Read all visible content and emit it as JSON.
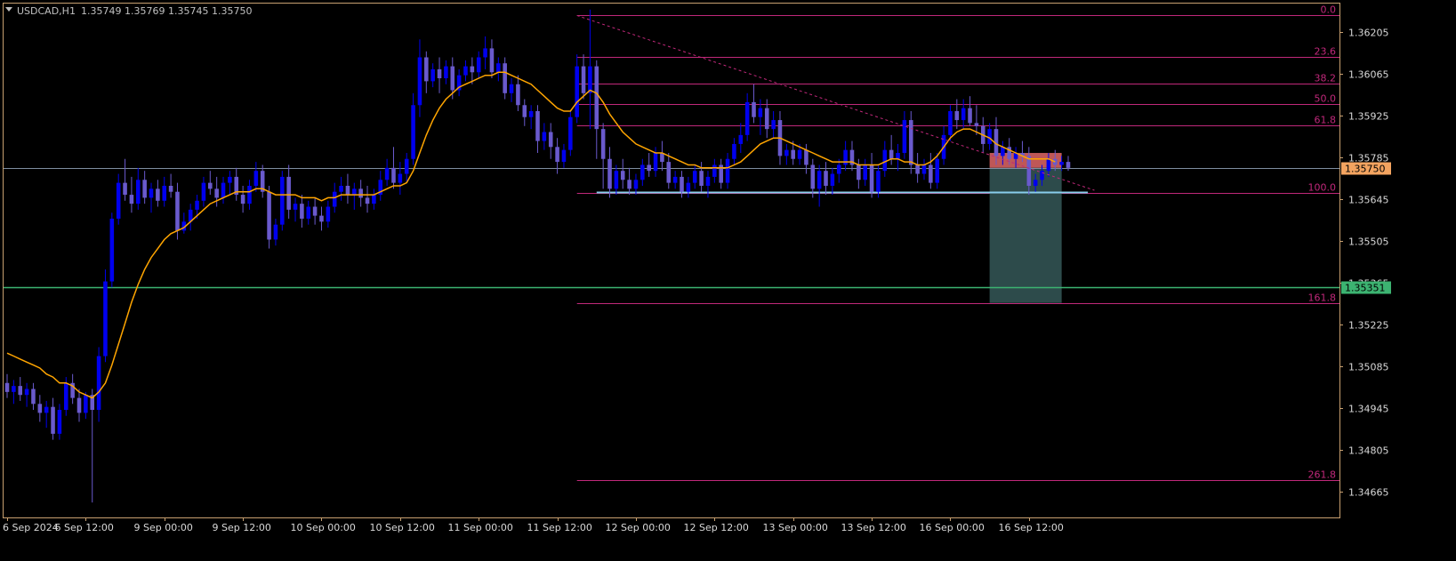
{
  "header": {
    "symbol": "USDCAD,H1",
    "ohlc": "1.35749 1.35769 1.35745 1.35750",
    "dropdown_icon": "triangle-down-icon"
  },
  "colors": {
    "background": "#000000",
    "frame": "#c8a070",
    "bull_candle": "#0000ee",
    "bear_candle": "#6a5acd",
    "moving_average": "#ffa500",
    "fib_level": "#c0287a",
    "fib_text": "#c0287a",
    "trend_line": "#c0287a",
    "support_line": "#87ceeb",
    "price_line": "#7f8da0",
    "target_line": "#3cb371",
    "risk_box": "#e06666",
    "reward_box": "#2f4f4f",
    "current_price_label": "#f4a460",
    "target_price_label": "#3cb371"
  },
  "chart_data": {
    "type": "candlestick",
    "symbol": "USDCAD",
    "timeframe": "H1",
    "ylim": [
      1.3458,
      1.363
    ],
    "grid": false,
    "y_ticks": [
      "1.36205",
      "1.36065",
      "1.35925",
      "1.35785",
      "1.35645",
      "1.35505",
      "1.35365",
      "1.35225",
      "1.35085",
      "1.34945",
      "1.34805",
      "1.34665"
    ],
    "x_ticks": [
      "6 Sep 2024",
      "6 Sep 12:00",
      "9 Sep 00:00",
      "9 Sep 12:00",
      "10 Sep 00:00",
      "10 Sep 12:00",
      "11 Sep 00:00",
      "11 Sep 12:00",
      "12 Sep 00:00",
      "12 Sep 12:00",
      "13 Sep 00:00",
      "13 Sep 12:00",
      "16 Sep 00:00",
      "16 Sep 12:00"
    ],
    "candles": [
      [
        1.3503,
        1.3506,
        1.3498,
        1.35
      ],
      [
        1.35,
        1.3504,
        1.3496,
        1.3502
      ],
      [
        1.3502,
        1.3505,
        1.3497,
        1.3499
      ],
      [
        1.3499,
        1.3503,
        1.3495,
        1.3501
      ],
      [
        1.3501,
        1.3503,
        1.3494,
        1.3496
      ],
      [
        1.3496,
        1.3499,
        1.349,
        1.3493
      ],
      [
        1.3493,
        1.3497,
        1.3488,
        1.3495
      ],
      [
        1.3495,
        1.3498,
        1.3484,
        1.3486
      ],
      [
        1.3486,
        1.3496,
        1.3484,
        1.3494
      ],
      [
        1.3494,
        1.3505,
        1.3492,
        1.3503
      ],
      [
        1.3503,
        1.3506,
        1.3496,
        1.3498
      ],
      [
        1.3498,
        1.3501,
        1.349,
        1.3493
      ],
      [
        1.3493,
        1.35,
        1.3491,
        1.3499
      ],
      [
        1.3499,
        1.3501,
        1.3463,
        1.3494
      ],
      [
        1.3494,
        1.3515,
        1.349,
        1.3512
      ],
      [
        1.3512,
        1.3541,
        1.351,
        1.3537
      ],
      [
        1.3537,
        1.356,
        1.3535,
        1.3558
      ],
      [
        1.3558,
        1.3573,
        1.3556,
        1.357
      ],
      [
        1.357,
        1.3578,
        1.3564,
        1.3566
      ],
      [
        1.3566,
        1.3572,
        1.356,
        1.3563
      ],
      [
        1.3563,
        1.3575,
        1.3561,
        1.3571
      ],
      [
        1.3571,
        1.3574,
        1.3563,
        1.3565
      ],
      [
        1.3565,
        1.357,
        1.356,
        1.3568
      ],
      [
        1.3568,
        1.3571,
        1.3562,
        1.3564
      ],
      [
        1.3564,
        1.3572,
        1.3562,
        1.3569
      ],
      [
        1.3569,
        1.3573,
        1.3565,
        1.3567
      ],
      [
        1.3567,
        1.357,
        1.3551,
        1.3554
      ],
      [
        1.3554,
        1.356,
        1.3553,
        1.3557
      ],
      [
        1.3557,
        1.3563,
        1.3554,
        1.3561
      ],
      [
        1.3561,
        1.3566,
        1.3558,
        1.3564
      ],
      [
        1.3564,
        1.3572,
        1.3562,
        1.357
      ],
      [
        1.357,
        1.3574,
        1.3566,
        1.3568
      ],
      [
        1.3568,
        1.3572,
        1.3562,
        1.3565
      ],
      [
        1.3565,
        1.3572,
        1.3563,
        1.357
      ],
      [
        1.357,
        1.3574,
        1.3566,
        1.3572
      ],
      [
        1.3572,
        1.3575,
        1.3564,
        1.3566
      ],
      [
        1.3566,
        1.3569,
        1.356,
        1.3563
      ],
      [
        1.3563,
        1.3571,
        1.3561,
        1.3569
      ],
      [
        1.3569,
        1.3577,
        1.3567,
        1.3574
      ],
      [
        1.3574,
        1.3576,
        1.3565,
        1.3567
      ],
      [
        1.3567,
        1.3569,
        1.3548,
        1.3551
      ],
      [
        1.3551,
        1.3558,
        1.3549,
        1.3556
      ],
      [
        1.3556,
        1.3574,
        1.3554,
        1.3572
      ],
      [
        1.3572,
        1.3576,
        1.3558,
        1.3561
      ],
      [
        1.3561,
        1.3565,
        1.3557,
        1.3563
      ],
      [
        1.3563,
        1.3566,
        1.3555,
        1.3558
      ],
      [
        1.3558,
        1.3564,
        1.3556,
        1.3562
      ],
      [
        1.3562,
        1.3565,
        1.3556,
        1.3559
      ],
      [
        1.3559,
        1.3562,
        1.3554,
        1.3557
      ],
      [
        1.3557,
        1.3564,
        1.3555,
        1.3562
      ],
      [
        1.3562,
        1.357,
        1.356,
        1.3567
      ],
      [
        1.3567,
        1.3572,
        1.3564,
        1.3569
      ],
      [
        1.3569,
        1.3573,
        1.3563,
        1.3566
      ],
      [
        1.3566,
        1.357,
        1.3561,
        1.3568
      ],
      [
        1.3568,
        1.3571,
        1.3562,
        1.3565
      ],
      [
        1.3565,
        1.3569,
        1.356,
        1.3563
      ],
      [
        1.3563,
        1.3568,
        1.3561,
        1.3566
      ],
      [
        1.3566,
        1.3574,
        1.3564,
        1.3571
      ],
      [
        1.3571,
        1.3578,
        1.3569,
        1.3575
      ],
      [
        1.3575,
        1.3582,
        1.3568,
        1.357
      ],
      [
        1.357,
        1.3577,
        1.3566,
        1.3573
      ],
      [
        1.3573,
        1.358,
        1.357,
        1.3578
      ],
      [
        1.3578,
        1.36,
        1.3576,
        1.3596
      ],
      [
        1.3596,
        1.3618,
        1.3592,
        1.3612
      ],
      [
        1.3612,
        1.3614,
        1.36,
        1.3604
      ],
      [
        1.3604,
        1.361,
        1.3602,
        1.3608
      ],
      [
        1.3608,
        1.3612,
        1.36,
        1.3605
      ],
      [
        1.3605,
        1.3611,
        1.3603,
        1.3609
      ],
      [
        1.3609,
        1.3612,
        1.3598,
        1.3601
      ],
      [
        1.3601,
        1.3608,
        1.3599,
        1.3606
      ],
      [
        1.3606,
        1.3611,
        1.3604,
        1.3609
      ],
      [
        1.3609,
        1.3612,
        1.3603,
        1.3607
      ],
      [
        1.3607,
        1.3614,
        1.3605,
        1.3612
      ],
      [
        1.3612,
        1.3619,
        1.3608,
        1.3615
      ],
      [
        1.3615,
        1.3618,
        1.3605,
        1.3607
      ],
      [
        1.3607,
        1.3612,
        1.3604,
        1.361
      ],
      [
        1.361,
        1.3612,
        1.3598,
        1.36
      ],
      [
        1.36,
        1.3605,
        1.3597,
        1.3603
      ],
      [
        1.3603,
        1.3606,
        1.3594,
        1.3596
      ],
      [
        1.3596,
        1.3598,
        1.3589,
        1.3592
      ],
      [
        1.3592,
        1.3596,
        1.3588,
        1.3594
      ],
      [
        1.3594,
        1.3596,
        1.358,
        1.3584
      ],
      [
        1.3584,
        1.359,
        1.3581,
        1.3587
      ],
      [
        1.3587,
        1.359,
        1.3578,
        1.3582
      ],
      [
        1.3582,
        1.3585,
        1.3573,
        1.3577
      ],
      [
        1.3577,
        1.3583,
        1.3575,
        1.3581
      ],
      [
        1.3581,
        1.3594,
        1.3579,
        1.3592
      ],
      [
        1.3592,
        1.3613,
        1.359,
        1.3609
      ],
      [
        1.3609,
        1.3613,
        1.3598,
        1.36
      ],
      [
        1.36,
        1.3628,
        1.3588,
        1.3609
      ],
      [
        1.3609,
        1.3611,
        1.3578,
        1.3588
      ],
      [
        1.3588,
        1.359,
        1.3568,
        1.3578
      ],
      [
        1.3578,
        1.3582,
        1.3565,
        1.3568
      ],
      [
        1.3568,
        1.3576,
        1.3566,
        1.3574
      ],
      [
        1.3574,
        1.3578,
        1.3568,
        1.3571
      ],
      [
        1.3571,
        1.3575,
        1.3566,
        1.3568
      ],
      [
        1.3568,
        1.3573,
        1.3566,
        1.3571
      ],
      [
        1.3571,
        1.3578,
        1.3569,
        1.3576
      ],
      [
        1.3576,
        1.358,
        1.3572,
        1.3574
      ],
      [
        1.3574,
        1.3582,
        1.3572,
        1.358
      ],
      [
        1.358,
        1.3584,
        1.3574,
        1.3577
      ],
      [
        1.3577,
        1.358,
        1.3568,
        1.357
      ],
      [
        1.357,
        1.3574,
        1.3568,
        1.3572
      ],
      [
        1.3572,
        1.3574,
        1.3565,
        1.3567
      ],
      [
        1.3567,
        1.3572,
        1.3565,
        1.357
      ],
      [
        1.357,
        1.3576,
        1.3568,
        1.3574
      ],
      [
        1.3574,
        1.3577,
        1.3567,
        1.3569
      ],
      [
        1.3569,
        1.3574,
        1.3565,
        1.3572
      ],
      [
        1.3572,
        1.3578,
        1.357,
        1.3576
      ],
      [
        1.3576,
        1.3578,
        1.3568,
        1.357
      ],
      [
        1.357,
        1.358,
        1.3568,
        1.3578
      ],
      [
        1.3578,
        1.3585,
        1.3576,
        1.3583
      ],
      [
        1.3583,
        1.359,
        1.358,
        1.3586
      ],
      [
        1.3586,
        1.36,
        1.3584,
        1.3597
      ],
      [
        1.3597,
        1.3603,
        1.359,
        1.3592
      ],
      [
        1.3592,
        1.3598,
        1.3586,
        1.3595
      ],
      [
        1.3595,
        1.3598,
        1.3585,
        1.3588
      ],
      [
        1.3588,
        1.3594,
        1.3585,
        1.3591
      ],
      [
        1.3591,
        1.3594,
        1.3576,
        1.3579
      ],
      [
        1.3579,
        1.3583,
        1.3576,
        1.3581
      ],
      [
        1.3581,
        1.3584,
        1.3576,
        1.3578
      ],
      [
        1.3578,
        1.3583,
        1.3576,
        1.3581
      ],
      [
        1.3581,
        1.3583,
        1.3573,
        1.3576
      ],
      [
        1.3576,
        1.3578,
        1.3565,
        1.3568
      ],
      [
        1.3568,
        1.3576,
        1.3562,
        1.3574
      ],
      [
        1.3574,
        1.3577,
        1.3566,
        1.3569
      ],
      [
        1.3569,
        1.3575,
        1.3566,
        1.3573
      ],
      [
        1.3573,
        1.3578,
        1.357,
        1.3576
      ],
      [
        1.3576,
        1.3584,
        1.3574,
        1.3581
      ],
      [
        1.3581,
        1.3584,
        1.3574,
        1.3576
      ],
      [
        1.3576,
        1.3578,
        1.3568,
        1.3571
      ],
      [
        1.3571,
        1.3578,
        1.3569,
        1.3576
      ],
      [
        1.3576,
        1.358,
        1.3565,
        1.3567
      ],
      [
        1.3567,
        1.3576,
        1.3565,
        1.3574
      ],
      [
        1.3574,
        1.3584,
        1.3572,
        1.3581
      ],
      [
        1.3581,
        1.3586,
        1.3576,
        1.3578
      ],
      [
        1.3578,
        1.3583,
        1.3574,
        1.358
      ],
      [
        1.358,
        1.3594,
        1.3578,
        1.3591
      ],
      [
        1.3591,
        1.3594,
        1.3573,
        1.3576
      ],
      [
        1.3576,
        1.358,
        1.357,
        1.3573
      ],
      [
        1.3573,
        1.3578,
        1.3571,
        1.3576
      ],
      [
        1.3576,
        1.358,
        1.3568,
        1.357
      ],
      [
        1.357,
        1.358,
        1.3568,
        1.3578
      ],
      [
        1.3578,
        1.3589,
        1.3576,
        1.3586
      ],
      [
        1.3586,
        1.3596,
        1.3584,
        1.3594
      ],
      [
        1.3594,
        1.3598,
        1.3588,
        1.3591
      ],
      [
        1.3591,
        1.3598,
        1.3588,
        1.3595
      ],
      [
        1.3595,
        1.3599,
        1.3589,
        1.359
      ],
      [
        1.359,
        1.3596,
        1.3586,
        1.3589
      ],
      [
        1.3589,
        1.3592,
        1.358,
        1.3583
      ],
      [
        1.3583,
        1.359,
        1.3581,
        1.3588
      ],
      [
        1.3588,
        1.3592,
        1.3576,
        1.3579
      ],
      [
        1.3579,
        1.3584,
        1.3576,
        1.3582
      ],
      [
        1.3582,
        1.3585,
        1.3576,
        1.3578
      ],
      [
        1.3578,
        1.3582,
        1.3575,
        1.358
      ],
      [
        1.358,
        1.3584,
        1.3577,
        1.3579
      ],
      [
        1.3579,
        1.3582,
        1.3566,
        1.3569
      ],
      [
        1.3569,
        1.3573,
        1.3567,
        1.3571
      ],
      [
        1.3571,
        1.3576,
        1.3569,
        1.3574
      ],
      [
        1.3574,
        1.358,
        1.3572,
        1.3578
      ],
      [
        1.3578,
        1.3581,
        1.3574,
        1.3576
      ],
      [
        1.3576,
        1.3579,
        1.3574,
        1.3577
      ],
      [
        1.3577,
        1.3579,
        1.3574,
        1.3575
      ]
    ],
    "moving_average": [
      1.3513,
      1.3512,
      1.3511,
      1.351,
      1.3509,
      1.3508,
      1.3506,
      1.3505,
      1.3503,
      1.3503,
      1.3502,
      1.35,
      1.3499,
      1.3498,
      1.35,
      1.3503,
      1.3509,
      1.3516,
      1.3523,
      1.353,
      1.3536,
      1.3541,
      1.3545,
      1.3548,
      1.3551,
      1.3553,
      1.3554,
      1.3555,
      1.3557,
      1.3559,
      1.3561,
      1.3563,
      1.3564,
      1.3565,
      1.3566,
      1.3567,
      1.3567,
      1.3567,
      1.3568,
      1.3568,
      1.3567,
      1.3566,
      1.3566,
      1.3566,
      1.3566,
      1.3565,
      1.3565,
      1.3565,
      1.3564,
      1.3565,
      1.3565,
      1.3566,
      1.3566,
      1.3566,
      1.3566,
      1.3566,
      1.3566,
      1.3567,
      1.3568,
      1.3569,
      1.3569,
      1.357,
      1.3574,
      1.358,
      1.3586,
      1.3591,
      1.3595,
      1.3598,
      1.36,
      1.3602,
      1.3603,
      1.3604,
      1.3605,
      1.3606,
      1.3606,
      1.3607,
      1.3607,
      1.3606,
      1.3605,
      1.3604,
      1.3603,
      1.3601,
      1.3599,
      1.3597,
      1.3595,
      1.3594,
      1.3594,
      1.3597,
      1.3599,
      1.3601,
      1.36,
      1.3597,
      1.3593,
      1.359,
      1.3587,
      1.3585,
      1.3583,
      1.3582,
      1.3581,
      1.358,
      1.358,
      1.3579,
      1.3578,
      1.3577,
      1.3576,
      1.3576,
      1.3575,
      1.3575,
      1.3575,
      1.3575,
      1.3575,
      1.3576,
      1.3577,
      1.3579,
      1.3581,
      1.3583,
      1.3584,
      1.3585,
      1.3585,
      1.3584,
      1.3583,
      1.3582,
      1.3581,
      1.358,
      1.3579,
      1.3578,
      1.3577,
      1.3577,
      1.3577,
      1.3577,
      1.3576,
      1.3576,
      1.3576,
      1.3576,
      1.3577,
      1.3578,
      1.3578,
      1.3577,
      1.3577,
      1.3576,
      1.3576,
      1.3577,
      1.3579,
      1.3582,
      1.3585,
      1.3587,
      1.3588,
      1.3588,
      1.3587,
      1.3586,
      1.3585,
      1.3583,
      1.3582,
      1.3581,
      1.358,
      1.3579,
      1.3578,
      1.3578,
      1.3578,
      1.3578,
      1.3577
    ],
    "fibonacci": {
      "start_index": 87,
      "end_index": 162,
      "levels": [
        {
          "label": "0.0",
          "price": 1.3626
        },
        {
          "label": "23.6",
          "price": 1.3612
        },
        {
          "label": "38.2",
          "price": 1.36033
        },
        {
          "label": "50.0",
          "price": 1.35963
        },
        {
          "label": "61.8",
          "price": 1.35893
        },
        {
          "label": "100.0",
          "price": 1.35666
        },
        {
          "label": "161.8",
          "price": 1.35298
        },
        {
          "label": "261.8",
          "price": 1.34705
        }
      ]
    },
    "trend_line": {
      "from": [
        87,
        1.3626
      ],
      "to": [
        166,
        1.35675
      ]
    },
    "support_line": {
      "price": 1.35668,
      "from_index": 90,
      "to_index": 165
    },
    "current_price": {
      "price": 1.3575,
      "label": "1.35750"
    },
    "target_price": {
      "price": 1.35351,
      "label": "1.35351"
    },
    "position": {
      "from_index": 150,
      "to_index": 161,
      "entry": 1.3575,
      "stop": 1.358,
      "target": 1.35298
    }
  }
}
